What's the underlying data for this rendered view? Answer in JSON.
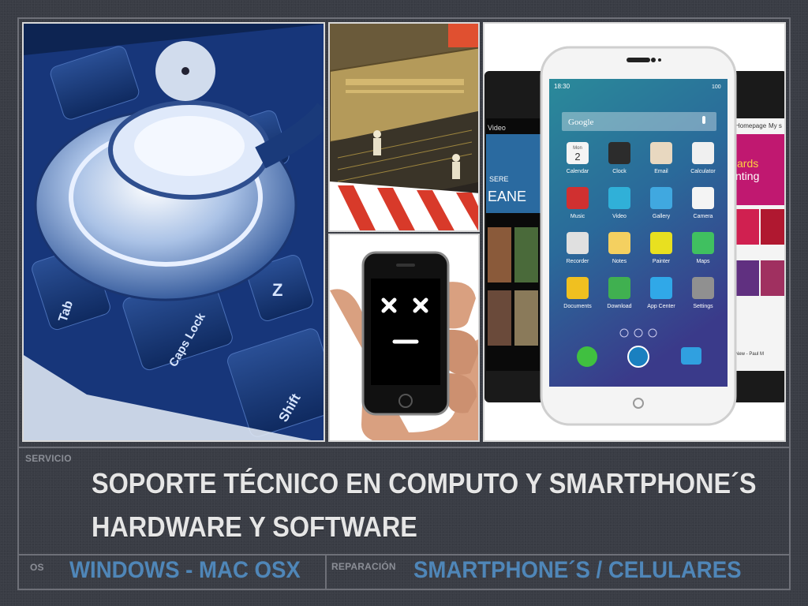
{
  "servicio": {
    "label": "SERVICIO",
    "title_line1": "SOPORTE TÉCNICO EN COMPUTO Y SMARTPHONE´S",
    "title_line2": "HARDWARE Y SOFTWARE"
  },
  "os": {
    "label": "OS",
    "value": "WINDOWS - MAC OSX"
  },
  "reparacion": {
    "label": "REPARACIÓN",
    "value": "SMARTPHONE´S / CELULARES"
  },
  "keyboard": {
    "keys": [
      "Tab",
      "Caps Lock",
      "Shift",
      "Z"
    ]
  },
  "phone": {
    "time": "18:30",
    "battery": "100",
    "search_placeholder": "Google",
    "apps": [
      {
        "label": "Calendar",
        "color": "#f4f4f4"
      },
      {
        "label": "Clock",
        "color": "#2c2c2c"
      },
      {
        "label": "Email",
        "color": "#e8d8c0"
      },
      {
        "label": "Calculator",
        "color": "#f0f0f0"
      },
      {
        "label": "Music",
        "color": "#d03030"
      },
      {
        "label": "Video",
        "color": "#30b0d8"
      },
      {
        "label": "Gallery",
        "color": "#40a8e0"
      },
      {
        "label": "Camera",
        "color": "#f4f4f4"
      },
      {
        "label": "Recorder",
        "color": "#e0e0e0"
      },
      {
        "label": "Notes",
        "color": "#f4d060"
      },
      {
        "label": "Painter",
        "color": "#e8e020"
      },
      {
        "label": "Maps",
        "color": "#40c060"
      },
      {
        "label": "Documents",
        "color": "#f0c020"
      },
      {
        "label": "Download",
        "color": "#40b050"
      },
      {
        "label": "App Center",
        "color": "#30a8e8"
      },
      {
        "label": "Settings",
        "color": "#909090"
      }
    ],
    "calendar_day": "2",
    "calendar_month": "Mon",
    "left_screen": {
      "tab": "Video",
      "text1": "SERE",
      "text2": "EANE"
    },
    "right_screen": {
      "tab1": "Homepage",
      "tab2": "My s",
      "text1": "ards",
      "text2": "nting",
      "bottom": "New - Paul M"
    }
  },
  "colors": {
    "background": "#3a3d45",
    "accent_blue": "#4f86b8",
    "title_text": "#e6e6e6",
    "label_gray": "#8b8e96",
    "frame_line": "#6e7078"
  }
}
